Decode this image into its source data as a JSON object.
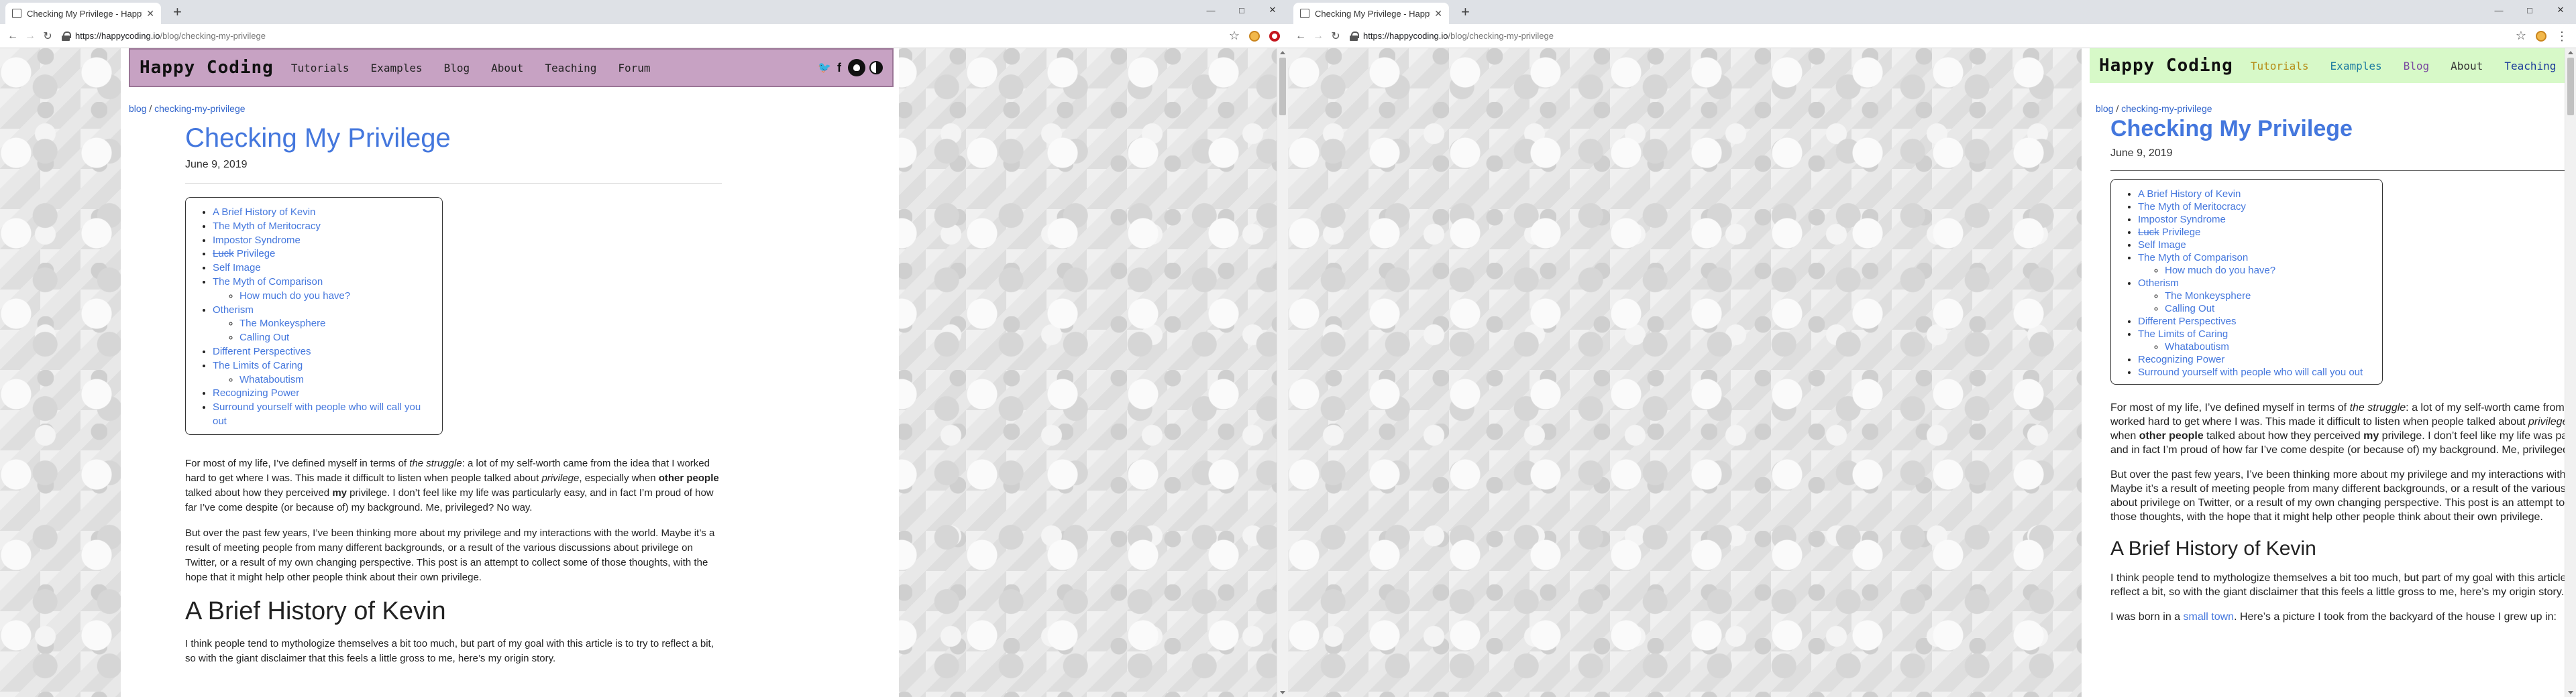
{
  "browser": {
    "tab_title": "Checking My Privilege - Happy C",
    "tab_title_right": "Checking My Privilege - Happy Co",
    "url_host": "https://happycoding.io",
    "url_path": "/blog/checking-my-privilege",
    "new_tab": "+",
    "minimize": "—",
    "maximize": "□",
    "close": "✕",
    "back": "←",
    "forward": "→",
    "reload": "↻",
    "star": "☆",
    "menu": "⋮"
  },
  "header": {
    "brand": "Happy Coding",
    "nav": [
      "Tutorials",
      "Examples",
      "Blog",
      "About",
      "Teaching",
      "Forum"
    ],
    "twitter_glyph": "🐦",
    "facebook_glyph": "f"
  },
  "breadcrumb": {
    "root": "blog",
    "sep": " / ",
    "current": "checking-my-privilege"
  },
  "post": {
    "title": "Checking My Privilege",
    "date": "June 9, 2019"
  },
  "toc": [
    {
      "label": "A Brief History of Kevin"
    },
    {
      "label": "The Myth of Meritocracy"
    },
    {
      "label": "Impostor Syndrome"
    },
    {
      "label_strike": "Luck",
      "label": " Privilege"
    },
    {
      "label": "Self Image"
    },
    {
      "label": "The Myth of Comparison",
      "children": [
        "How much do you have?"
      ]
    },
    {
      "label": "Otherism",
      "children": [
        "The Monkeysphere",
        "Calling Out"
      ]
    },
    {
      "label": "Different Perspectives"
    },
    {
      "label": "The Limits of Caring",
      "children": [
        "Whataboutism"
      ]
    },
    {
      "label": "Recognizing Power"
    },
    {
      "label": "Surround yourself with people who will call you out"
    }
  ],
  "body": {
    "p1_a": "For most of my life, I’ve defined myself in terms of ",
    "p1_em": "the struggle",
    "p1_b": ": a lot of my self-worth came from the idea that I worked hard to get where I was. This made it difficult to listen when people talked about ",
    "p1_em2": "privilege",
    "p1_c": ", especially when ",
    "p1_strong": "other people",
    "p1_d": " talked about how they perceived ",
    "p1_strong2": "my",
    "p1_e": " privilege. I don’t feel like my life was particularly easy, and in fact I’m proud of how far I’ve come despite (or because of) my background. Me, privileged? No way.",
    "p2": "But over the past few years, I’ve been thinking more about my privilege and my interactions with the world. Maybe it’s a result of meeting people from many different backgrounds, or a result of the various discussions about privilege on Twitter, or a result of my own changing perspective. This post is an attempt to collect some of those thoughts, with the hope that it might help other people think about their own privilege.",
    "h_kevin": "A Brief History of Kevin",
    "p3": "I think people tend to mythologize themselves a bit too much, but part of my goal with this article is to try to reflect a bit, so with the giant disclaimer that this feels a little gross to me, here’s my origin story.",
    "p4_a": "I was born in a ",
    "p4_link": "small town",
    "p4_b": ". Here’s a picture I took from the backyard of the house I grew up in:"
  }
}
